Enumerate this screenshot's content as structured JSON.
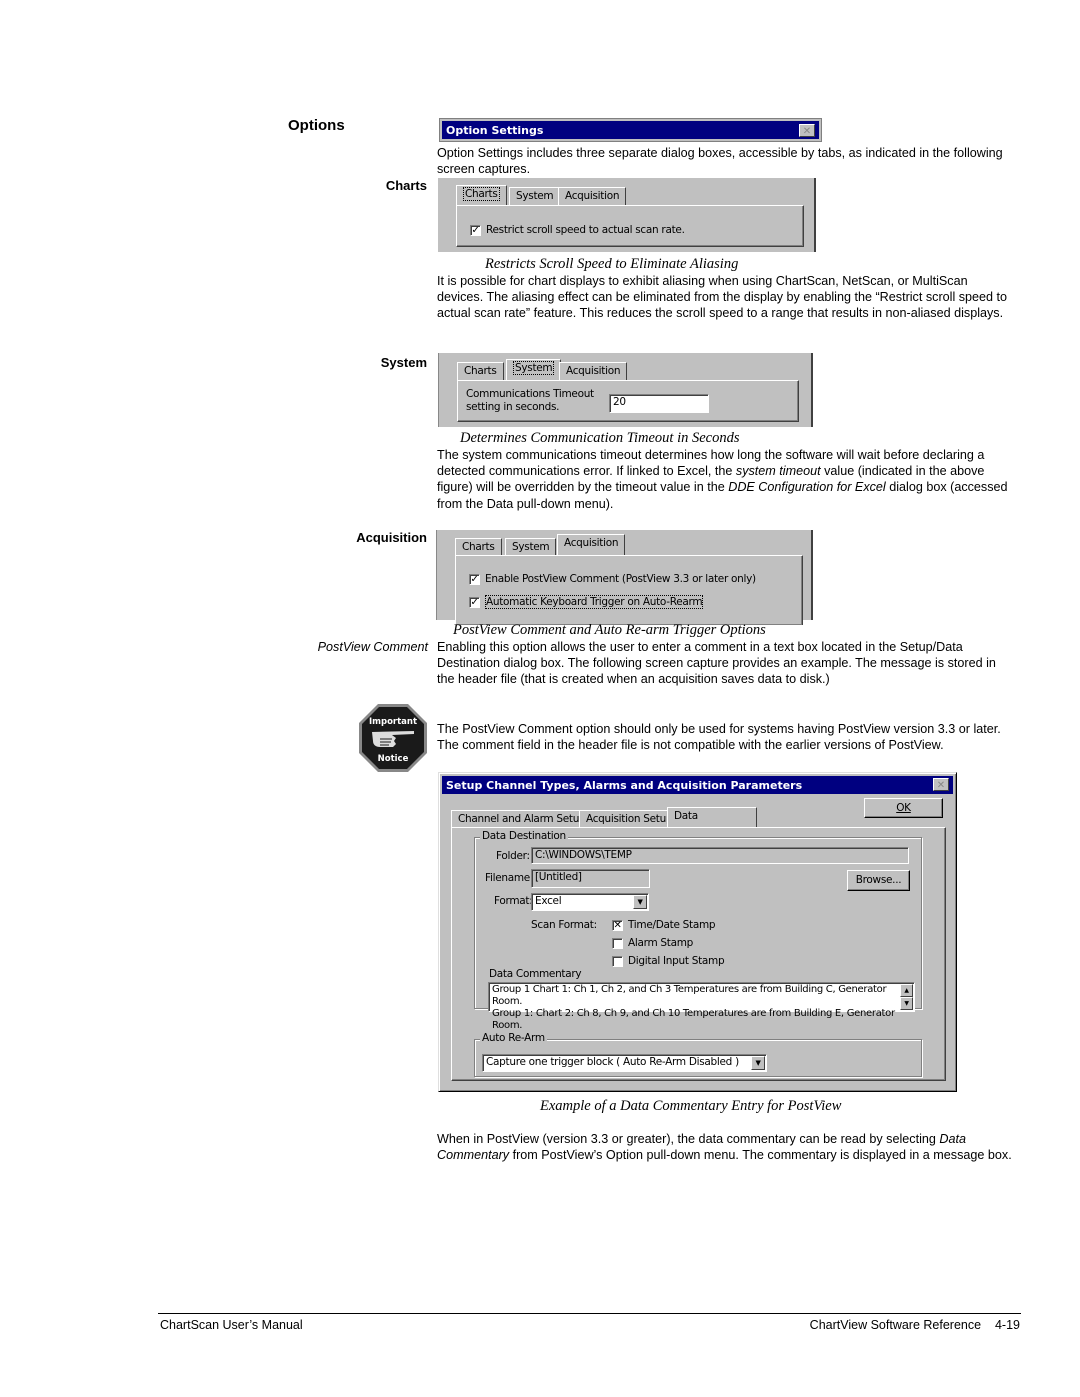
{
  "section_title": "Options",
  "option_settings_titlebar": {
    "title": "Option Settings",
    "close_icon": "close-icon"
  },
  "intro_text": "Option Settings includes three separate dialog boxes, accessible by tabs, as indicated in the following screen captures.",
  "tabs": [
    "Charts",
    "System",
    "Acquisition"
  ],
  "charts": {
    "side_heading": "Charts",
    "checkbox_label": "Restrict scroll speed to actual scan rate.",
    "checkbox_checked": true,
    "caption": "Restricts Scroll Speed to Eliminate Aliasing",
    "body": "It is possible for chart displays to exhibit aliasing when using ChartScan, NetScan, or MultiScan devices.  The aliasing effect can be eliminated from the display by enabling the “Restrict scroll speed to actual scan rate” feature.  This reduces the scroll speed to a range that results in non-aliased displays."
  },
  "system": {
    "side_heading": "System",
    "field_label_line1": "Communications Timeout",
    "field_label_line2": "setting in seconds.",
    "timeout_value": "20",
    "caption": "Determines Communication Timeout in Seconds",
    "body_part1": "The system communications timeout determines how long the software will wait before declaring a detected communications error.  If linked to Excel, the ",
    "body_italic1": "system timeout",
    "body_part2": " value (indicated in the above figure) will be overridden by the timeout value in the ",
    "body_italic2": "DDE Configuration for Excel",
    "body_part3": " dialog box (accessed from the Data pull-down menu)."
  },
  "acquisition": {
    "side_heading": "Acquisition",
    "checkbox1_label": "Enable PostView Comment (PostView 3.3 or later only)",
    "checkbox1_checked": true,
    "checkbox2_label": "Automatic Keyboard Trigger on Auto-Rearm",
    "checkbox2_checked": true,
    "caption": "PostView Comment and Auto Re-arm Trigger Options"
  },
  "postview_comment": {
    "side_heading": "PostView Comment",
    "body": "Enabling this option allows the user to enter a comment in a text box located in the Setup/Data Destination dialog box.  The following screen capture provides an example.  The message is stored in the header file (that is created when an acquisition saves data to disk.)",
    "notice_icon": {
      "top": "Important",
      "bottom": "Notice"
    },
    "notice_text": "The PostView Comment option should only be used for systems having PostView version 3.3 or later.  The comment field in the header file is not compatible with the earlier versions of PostView."
  },
  "setup_dialog": {
    "title": "Setup Channel Types, Alarms and Acquisition Parameters",
    "tabs": [
      {
        "label": "Channel and Alarm Setup",
        "mnemonic": "C"
      },
      {
        "label": "Acquisition Setup",
        "mnemonic": "A"
      },
      {
        "label": "Data Destination",
        "mnemonic": "D",
        "active": true
      }
    ],
    "ok_label": "OK",
    "group_data_destination": "Data Destination",
    "folder_label": "Folder:",
    "folder_value": "C:\\WINDOWS\\TEMP",
    "filename_label": "Filename:",
    "filename_value": "[Untitled]",
    "browse_label": "Browse...",
    "format_label": "Format:",
    "format_value": "Excel",
    "scan_format_label": "Scan Format:",
    "scan_options": [
      {
        "label": "Time/Date Stamp",
        "checked": true
      },
      {
        "label": "Alarm Stamp",
        "checked": false
      },
      {
        "label": "Digital Input Stamp",
        "checked": false
      }
    ],
    "commentary_label": "Data Commentary",
    "commentary_lines": [
      "Group 1 Chart 1: Ch 1, Ch 2, and Ch 3 Temperatures are from Building C, Generator Room.",
      "Group 1: Chart 2: Ch 8, Ch 9, and Ch 10 Temperatures are from  Building E, Generator Room."
    ],
    "group_auto_rearm": "Auto Re-Arm",
    "auto_rearm_value": "Capture one trigger block ( Auto Re-Arm Disabled )",
    "caption": "Example of a Data Commentary Entry for PostView"
  },
  "closing": {
    "part1": "When in PostView (version 3.3 or greater), the data commentary can be read by selecting ",
    "italic": "Data Commentary",
    "part2": " from PostView’s Option pull-down menu.  The commentary is displayed in a message box."
  },
  "footer": {
    "left": "ChartScan User’s Manual",
    "right": "ChartView Software Reference",
    "page": "4-19"
  }
}
